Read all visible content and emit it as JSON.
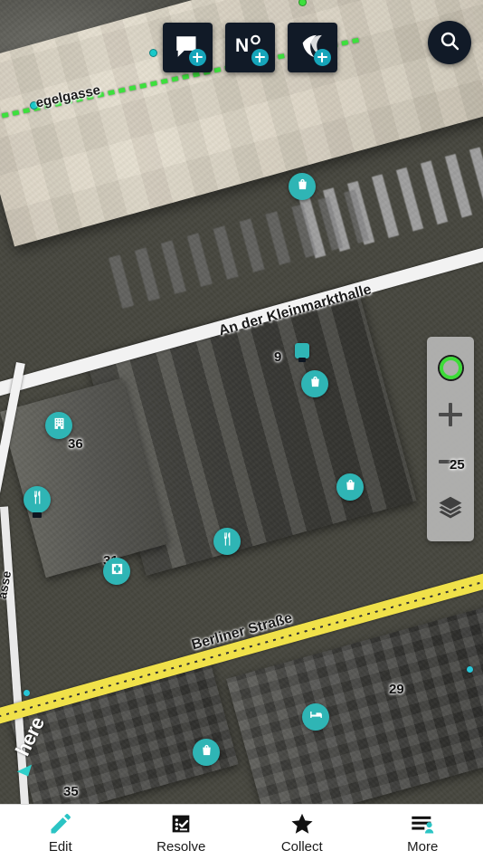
{
  "app": {
    "name": "here-maps-editor",
    "map_provider_watermark": "here"
  },
  "toolbar": {
    "buttons": [
      {
        "name": "add-comment",
        "icon": "speech-bubble-plus-icon",
        "label": ""
      },
      {
        "name": "add-house-number",
        "icon": "number-sign-plus-icon",
        "label": "N°"
      },
      {
        "name": "add-layer",
        "icon": "layers-plus-icon",
        "label": ""
      }
    ],
    "search": {
      "label": "",
      "icon": "search-icon"
    }
  },
  "map_controls": {
    "gps": {
      "icon": "gps-ring-icon",
      "state_color": "#3ddc38"
    },
    "zoom_in": {
      "label": "+",
      "icon": "plus-icon"
    },
    "zoom_out": {
      "label": "−",
      "icon": "minus-icon"
    },
    "layers": {
      "icon": "layers-stack-icon"
    }
  },
  "map": {
    "roads": [
      {
        "name": "an-der-kleinmarkthalle",
        "label": "An der Kleinmarkthalle",
        "style": "white"
      },
      {
        "name": "berliner-strasse",
        "label": "Berliner Straße",
        "style": "yellow-dotted"
      },
      {
        "name": "egelgasse",
        "label": "egelgasse",
        "style": "green-dotted"
      },
      {
        "name": "left-gasse",
        "label": "asse",
        "style": "white"
      }
    ],
    "house_numbers": [
      "9",
      "36",
      "31",
      "25",
      "29",
      "35"
    ],
    "pois": [
      {
        "name": "poi-shop-top",
        "icon": "shopping-bag-icon",
        "type": "shop"
      },
      {
        "name": "poi-shop-kleinmarkt",
        "icon": "shopping-bag-icon",
        "type": "shop"
      },
      {
        "name": "poi-building",
        "icon": "building-icon",
        "type": "building"
      },
      {
        "name": "poi-restaurant-left",
        "icon": "restaurant-icon",
        "type": "restaurant"
      },
      {
        "name": "poi-restaurant-center",
        "icon": "restaurant-icon",
        "type": "restaurant"
      },
      {
        "name": "poi-pharmacy",
        "icon": "medical-cross-icon",
        "type": "pharmacy"
      },
      {
        "name": "poi-shop-right",
        "icon": "shopping-bag-icon",
        "type": "shop"
      },
      {
        "name": "poi-hotel",
        "icon": "bed-icon",
        "type": "hotel"
      },
      {
        "name": "poi-shop-bottom",
        "icon": "shopping-bag-icon",
        "type": "shop"
      }
    ]
  },
  "bottom_nav": {
    "items": [
      {
        "label": "Edit",
        "icon": "pencil-icon",
        "active": true
      },
      {
        "label": "Resolve",
        "icon": "checklist-icon",
        "active": false
      },
      {
        "label": "Collect",
        "icon": "star-icon",
        "active": false
      },
      {
        "label": "More",
        "icon": "menu-person-icon",
        "active": false
      }
    ]
  },
  "colors": {
    "accent_teal": "#2fb5b5",
    "nav_active": "#2bc4c4",
    "button_dark": "#111a27",
    "road_yellow": "#f0e14a",
    "gps_green": "#3ddc38"
  }
}
